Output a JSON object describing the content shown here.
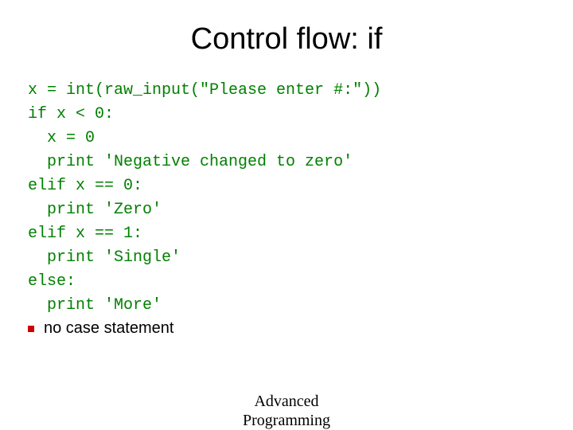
{
  "title": "Control flow: if",
  "code": {
    "line1": "x = int(raw_input(\"Please enter #:\"))",
    "line2": "if x < 0:",
    "line3": "  x = 0",
    "line4": "  print 'Negative changed to zero'",
    "line5": "elif x == 0:",
    "line6": "  print 'Zero'",
    "line7": "elif x == 1:",
    "line8": "  print 'Single'",
    "line9": "else:",
    "line10": "  print 'More'"
  },
  "bullet": {
    "text": "no case statement"
  },
  "footer": {
    "line1": "Advanced",
    "line2": "Programming"
  }
}
